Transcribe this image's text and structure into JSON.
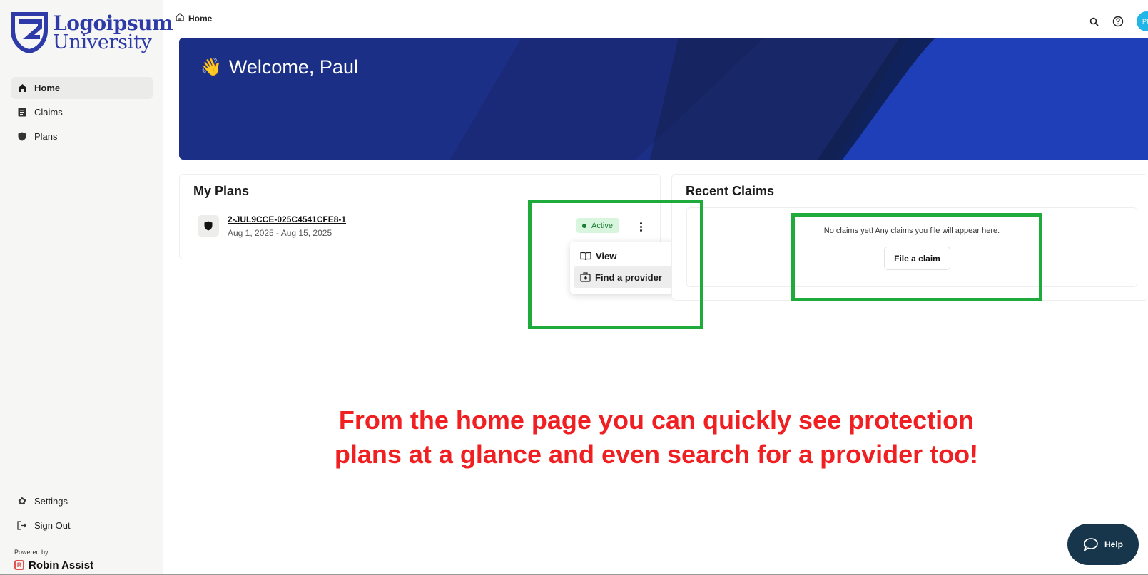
{
  "brand": {
    "name_line1": "Logoipsum",
    "name_line2": "University",
    "color": "#2d3aa8"
  },
  "sidebar": {
    "items": [
      {
        "label": "Home",
        "icon": "home-icon",
        "active": true
      },
      {
        "label": "Claims",
        "icon": "document-icon",
        "active": false
      },
      {
        "label": "Plans",
        "icon": "shield-icon",
        "active": false
      }
    ],
    "bottom_items": [
      {
        "label": "Settings",
        "icon": "gear-icon"
      },
      {
        "label": "Sign Out",
        "icon": "sign-out-icon"
      }
    ],
    "powered_by": "Powered by",
    "powered_brand": "Robin Assist"
  },
  "topbar": {
    "breadcrumb": "Home",
    "avatar_initials": "PP",
    "avatar_color": "#22b5e8"
  },
  "hero": {
    "emoji": "👋",
    "title": "Welcome, Paul",
    "bg_color": "#1b2f86"
  },
  "plans": {
    "title": "My Plans",
    "items": [
      {
        "id": "2-JUL9CCE-025C4541CFE8-1",
        "dates": "Aug 1, 2025 - Aug 15, 2025",
        "status": "Active"
      }
    ],
    "menu": [
      {
        "label": "View",
        "icon": "book-icon"
      },
      {
        "label": "Find a provider",
        "icon": "hospital-icon"
      }
    ]
  },
  "claims": {
    "title": "Recent Claims",
    "empty_text": "No claims yet! Any claims you file will appear here.",
    "file_button": "File a claim"
  },
  "annotation": {
    "line1": "From the home page you can quickly see protection",
    "line2": "plans at a glance and even search for a provider too!",
    "color": "#ef1f22",
    "highlight_color": "#1faa3c"
  },
  "help": {
    "label": "Help"
  }
}
